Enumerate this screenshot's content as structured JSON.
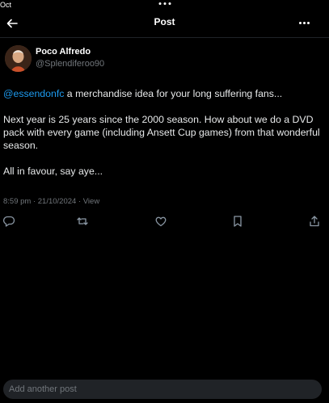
{
  "status_bar": {
    "date": "Oct"
  },
  "nav": {
    "title": "Post"
  },
  "post": {
    "author": {
      "display_name": "Poco Alfredo",
      "handle": "@Splendiferoo90"
    },
    "mention": "@essendonfc",
    "line1_rest": " a merchandise idea for your long suffering fans...",
    "paragraph2": "Next year is 25 years since the 2000 season. How about we do a DVD pack with every game (including Ansett Cup games) from that wonderful season.",
    "paragraph3": "All in favour, say aye...",
    "meta": "8:59 pm · 21/10/2024 · View"
  },
  "actions": {
    "icons": [
      "reply-icon",
      "repost-icon",
      "like-icon",
      "bookmark-icon",
      "share-icon"
    ]
  },
  "reply": {
    "placeholder": "Add another post"
  },
  "colors": {
    "background": "#000000",
    "text": "#e7e9ea",
    "secondary": "#71767b",
    "link": "#1d9bf0",
    "input_bg": "#202327"
  }
}
